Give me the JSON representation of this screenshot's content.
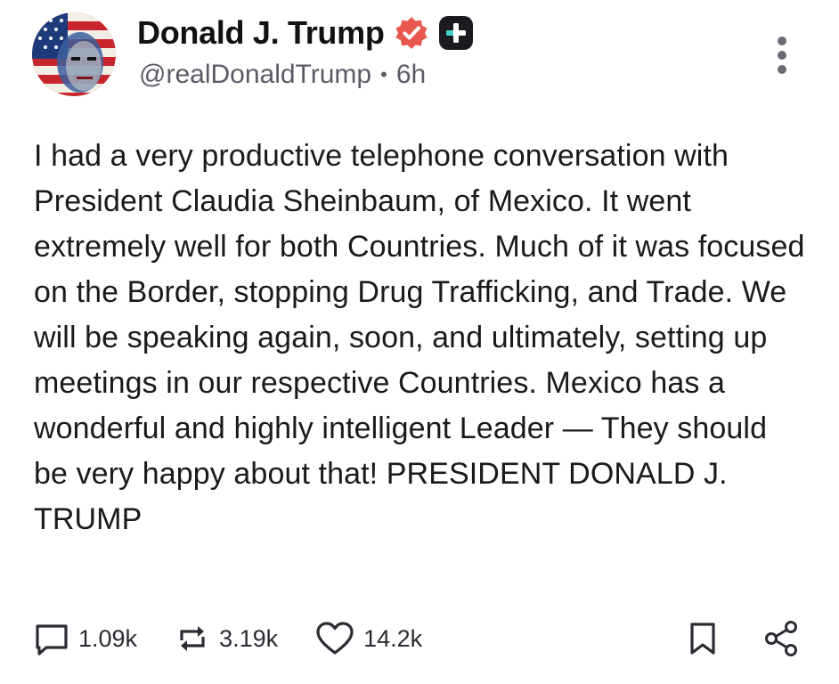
{
  "author": {
    "display_name": "Donald J. Trump",
    "handle": "@realDonaldTrump",
    "separator": "•",
    "time_ago": "6h",
    "avatar_icon": "flag-portrait-avatar",
    "verified_icon": "verified-badge-icon",
    "plus_icon": "plus-badge-icon"
  },
  "post": {
    "text": "I had a very productive telephone conversation with President Claudia Sheinbaum, of Mexico. It went extremely well for both Countries. Much of it was focused on the Border, stopping Drug Trafficking, and Trade. We will be speaking again, soon, and ultimately, setting up meetings in our respective Countries. Mexico has a wonderful and highly intelligent Leader — They should be very happy about that! PRESIDENT DONALD J. TRUMP"
  },
  "actions": {
    "replies": {
      "icon": "comment-icon",
      "count": "1.09k"
    },
    "retruths": {
      "icon": "repost-icon",
      "count": "3.19k"
    },
    "likes": {
      "icon": "heart-icon",
      "count": "14.2k"
    },
    "bookmark": {
      "icon": "bookmark-icon"
    },
    "share": {
      "icon": "share-icon"
    }
  },
  "colors": {
    "verified": "#e8584f",
    "plus_badge_bg": "#1b1b1f",
    "plus_badge_accent": "#3fd0c9",
    "text": "#1a1a1a",
    "muted": "#5b5b66"
  }
}
